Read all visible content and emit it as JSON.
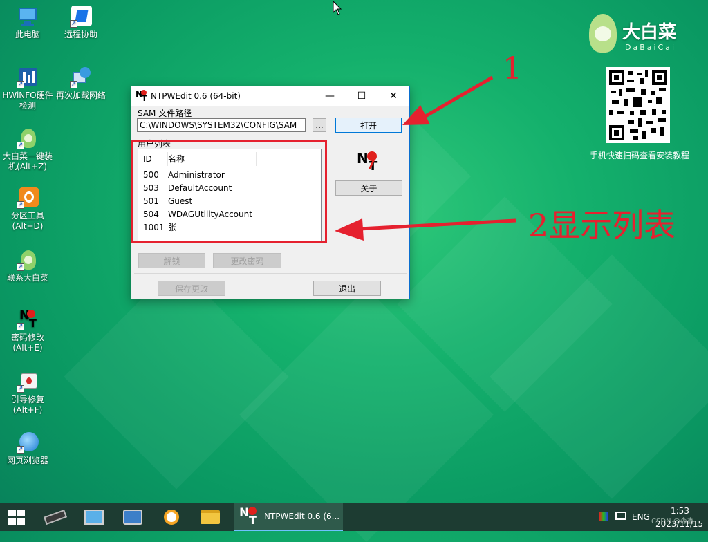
{
  "desktop": {
    "icons": [
      {
        "label": "此电脑",
        "icon": "computer-icon"
      },
      {
        "label": "远程协助",
        "icon": "remote-assist-icon"
      },
      {
        "label": "HWiNFO硬件检测",
        "icon": "hwinfo-icon"
      },
      {
        "label": "再次加载网络",
        "icon": "network-reload-icon"
      },
      {
        "label": "大白菜一键装机(Alt+Z)",
        "icon": "dabaicai-icon"
      },
      {
        "label": "分区工具(Alt+D)",
        "icon": "partition-tool-icon"
      },
      {
        "label": "联系大白菜",
        "icon": "dabaicai-contact-icon"
      },
      {
        "label": "密码修改(Alt+E)",
        "icon": "ntpwedit-icon"
      },
      {
        "label": "引导修复(Alt+F)",
        "icon": "boot-repair-icon"
      },
      {
        "label": "网页浏览器",
        "icon": "browser-icon"
      }
    ],
    "brand": {
      "name": "大白菜",
      "latin": "DaBaiCai"
    },
    "qr_caption": "手机快速扫码查看安装教程"
  },
  "window": {
    "title": "NTPWEdit 0.6 (64-bit)",
    "controls": {
      "minimize": "—",
      "maximize": "☐",
      "close": "✕"
    },
    "sam_label": "SAM 文件路径",
    "sam_path": "C:\\WINDOWS\\SYSTEM32\\CONFIG\\SAM",
    "browse_label": "...",
    "open_label": "打开",
    "user_list_label": "用户列表",
    "columns": [
      "ID",
      "名称"
    ],
    "users": [
      {
        "id": "500",
        "name": "Administrator"
      },
      {
        "id": "503",
        "name": "DefaultAccount"
      },
      {
        "id": "501",
        "name": "Guest"
      },
      {
        "id": "504",
        "name": "WDAGUtilityAccount"
      },
      {
        "id": "1001",
        "name": "张"
      }
    ],
    "about_label": "关于",
    "unlock_label": "解锁",
    "change_password_label": "更改密码",
    "save_label": "保存更改",
    "exit_label": "退出"
  },
  "annotations": {
    "one": "1",
    "two": "2显示列表",
    "color": "#e5212f"
  },
  "taskbar": {
    "active_app_label": "NTPWEdit 0.6 (6...",
    "lang": "ENG",
    "time": "1:53",
    "date": "2023/11/15",
    "watermark": "CSDN @森鑫"
  }
}
